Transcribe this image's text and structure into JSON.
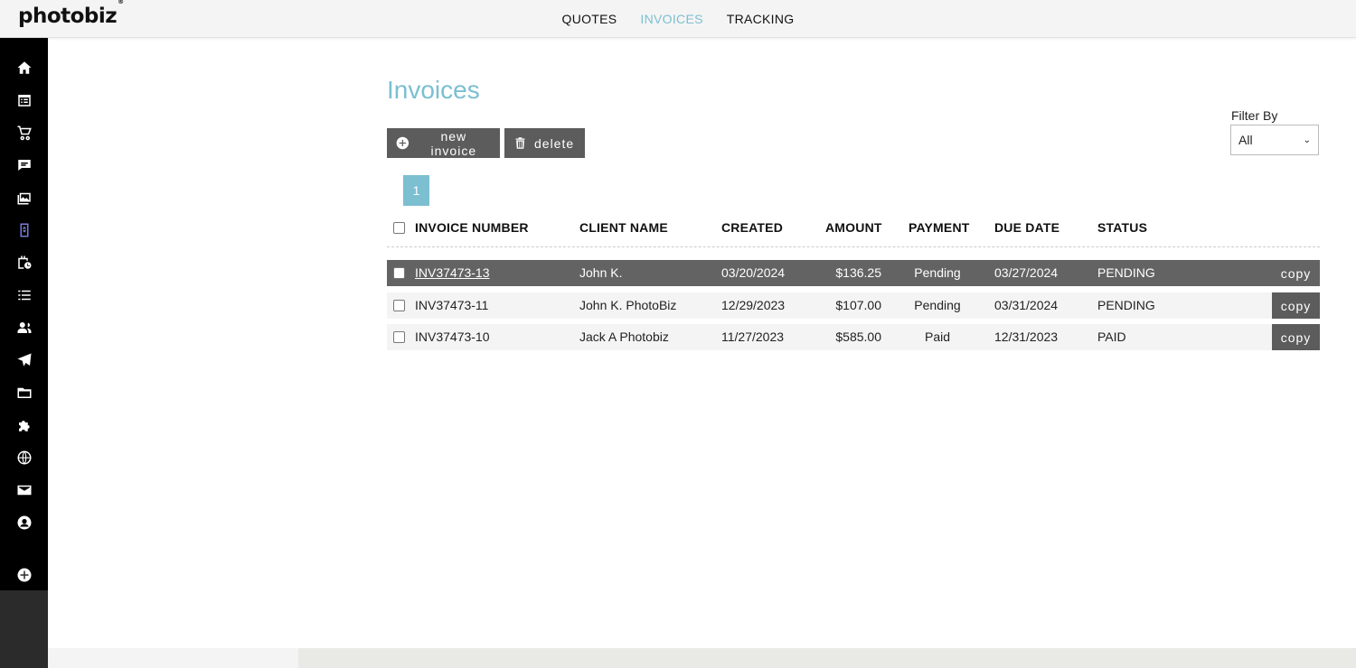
{
  "app": {
    "logo": "photobiz",
    "logo_mark": "®"
  },
  "topnav": [
    {
      "label": "QUOTES",
      "active": false
    },
    {
      "label": "INVOICES",
      "active": true
    },
    {
      "label": "TRACKING",
      "active": false
    }
  ],
  "sidebar": {
    "icons": [
      "home-icon",
      "calendar-list-icon",
      "cart-icon",
      "chat-icon",
      "gallery-icon",
      "invoice-icon",
      "calendar-clock-icon",
      "list-icon",
      "contacts-icon",
      "send-icon",
      "folder-icon",
      "puzzle-icon",
      "globe-icon",
      "mail-icon",
      "account-icon",
      "add-icon"
    ]
  },
  "page": {
    "title": "Invoices"
  },
  "toolbar": {
    "new_label": "new invoice",
    "delete_label": "delete"
  },
  "filter": {
    "label": "Filter By",
    "selected": "All"
  },
  "pagination": {
    "current": "1"
  },
  "table": {
    "headers": {
      "invoice_number": "INVOICE NUMBER",
      "client_name": "CLIENT NAME",
      "created": "CREATED",
      "amount": "AMOUNT",
      "payment": "PAYMENT",
      "due_date": "DUE DATE",
      "status": "STATUS"
    },
    "copy_label": "copy",
    "rows": [
      {
        "invoice": "INV37473-13",
        "client": "John K.",
        "created": "03/20/2024",
        "amount": "$136.25",
        "payment": "Pending",
        "due": "03/27/2024",
        "status": "PENDING",
        "highlighted": true
      },
      {
        "invoice": "INV37473-11",
        "client": "John K. PhotoBiz",
        "created": "12/29/2023",
        "amount": "$107.00",
        "payment": "Pending",
        "due": "03/31/2024",
        "status": "PENDING",
        "highlighted": false
      },
      {
        "invoice": "INV37473-10",
        "client": "Jack A Photobiz",
        "created": "11/27/2023",
        "amount": "$585.00",
        "payment": "Paid",
        "due": "12/31/2023",
        "status": "PAID",
        "highlighted": false
      }
    ]
  },
  "colors": {
    "accent": "#7bbfd1",
    "button": "#5c5c5c",
    "highlight_row": "#636363",
    "sidebar": "#000000"
  }
}
